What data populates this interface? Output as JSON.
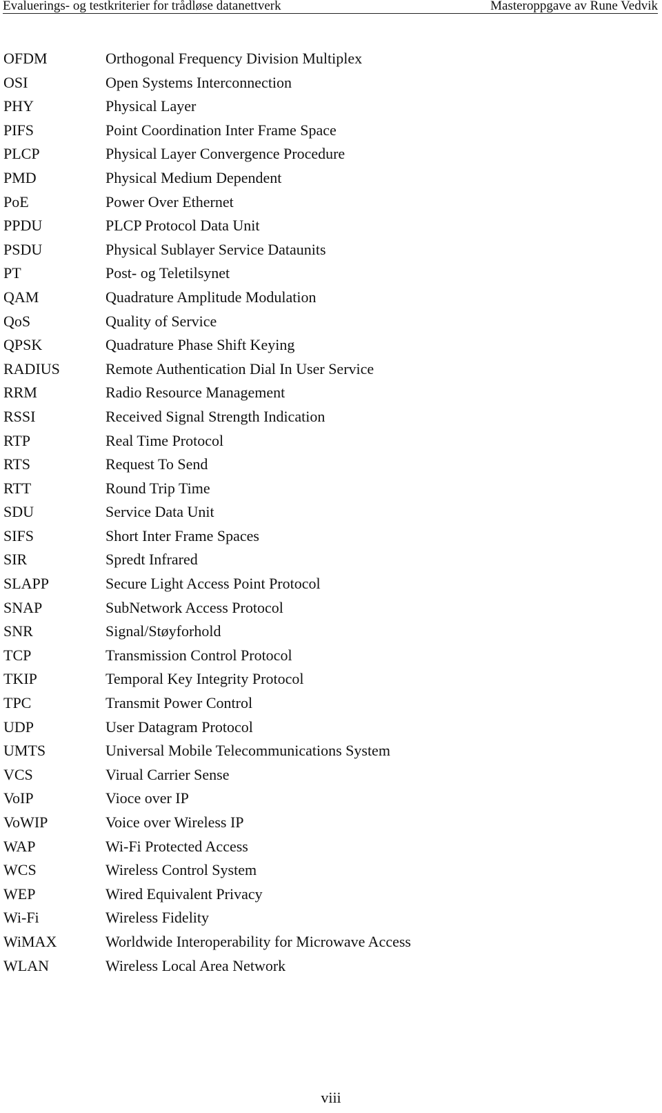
{
  "header": {
    "left_title": "Evaluerings- og testkriterier for trådløse datanettverk",
    "right_title": "Masteroppgave av Rune Vedvik"
  },
  "abbreviations": [
    {
      "abbr": "OFDM",
      "desc": "Orthogonal Frequency Division Multiplex"
    },
    {
      "abbr": "OSI",
      "desc": "Open Systems Interconnection"
    },
    {
      "abbr": "PHY",
      "desc": "Physical Layer"
    },
    {
      "abbr": "PIFS",
      "desc": "Point Coordination Inter Frame Space"
    },
    {
      "abbr": "PLCP",
      "desc": "Physical Layer Convergence Procedure"
    },
    {
      "abbr": "PMD",
      "desc": "Physical Medium Dependent"
    },
    {
      "abbr": "PoE",
      "desc": "Power Over Ethernet"
    },
    {
      "abbr": "PPDU",
      "desc": "PLCP Protocol Data Unit"
    },
    {
      "abbr": "PSDU",
      "desc": "Physical Sublayer Service Dataunits"
    },
    {
      "abbr": "PT",
      "desc": "Post- og Teletilsynet"
    },
    {
      "abbr": "QAM",
      "desc": "Quadrature Amplitude Modulation"
    },
    {
      "abbr": "QoS",
      "desc": "Quality of Service"
    },
    {
      "abbr": "QPSK",
      "desc": "Quadrature Phase Shift Keying"
    },
    {
      "abbr": "RADIUS",
      "desc": "Remote Authentication Dial In User Service"
    },
    {
      "abbr": "RRM",
      "desc": "Radio Resource Management"
    },
    {
      "abbr": "RSSI",
      "desc": "Received Signal Strength Indication"
    },
    {
      "abbr": "RTP",
      "desc": "Real Time Protocol"
    },
    {
      "abbr": "RTS",
      "desc": "Request To Send"
    },
    {
      "abbr": "RTT",
      "desc": "Round Trip Time"
    },
    {
      "abbr": "SDU",
      "desc": "Service Data Unit"
    },
    {
      "abbr": "SIFS",
      "desc": "Short Inter Frame Spaces"
    },
    {
      "abbr": "SIR",
      "desc": "Spredt Infrared"
    },
    {
      "abbr": "SLAPP",
      "desc": "Secure Light Access Point Protocol"
    },
    {
      "abbr": "SNAP",
      "desc": "SubNetwork Access Protocol"
    },
    {
      "abbr": "SNR",
      "desc": "Signal/Støyforhold"
    },
    {
      "abbr": "TCP",
      "desc": "Transmission Control Protocol"
    },
    {
      "abbr": "TKIP",
      "desc": "Temporal Key Integrity Protocol"
    },
    {
      "abbr": "TPC",
      "desc": "Transmit Power Control"
    },
    {
      "abbr": "UDP",
      "desc": "User Datagram Protocol"
    },
    {
      "abbr": "UMTS",
      "desc": "Universal Mobile Telecommunications System"
    },
    {
      "abbr": "VCS",
      "desc": "Virual Carrier Sense"
    },
    {
      "abbr": "VoIP",
      "desc": "Vioce over IP"
    },
    {
      "abbr": "VoWIP",
      "desc": "Voice over Wireless IP"
    },
    {
      "abbr": "WAP",
      "desc": "Wi-Fi Protected Access"
    },
    {
      "abbr": "WCS",
      "desc": "Wireless Control System"
    },
    {
      "abbr": "WEP",
      "desc": "Wired Equivalent Privacy"
    },
    {
      "abbr": "Wi-Fi",
      "desc": "Wireless Fidelity"
    },
    {
      "abbr": "WiMAX",
      "desc": "Worldwide Interoperability for Microwave Access"
    },
    {
      "abbr": "WLAN",
      "desc": "Wireless Local Area Network"
    }
  ],
  "footer": {
    "page_number": "viii"
  }
}
